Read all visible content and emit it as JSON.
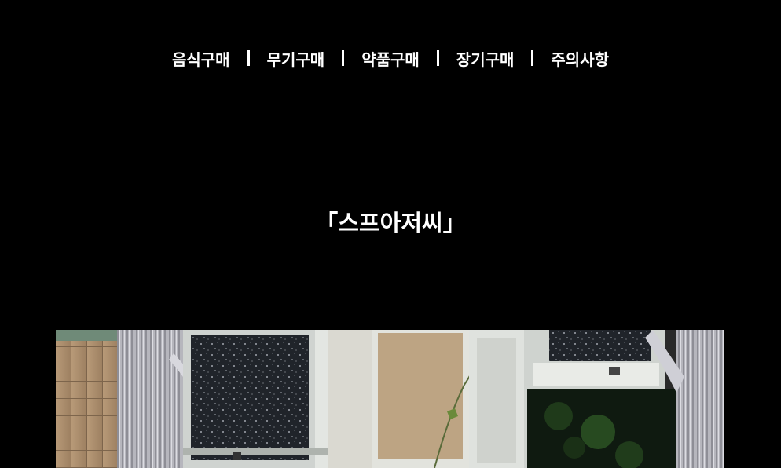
{
  "nav": {
    "items": [
      {
        "label": "음식구매"
      },
      {
        "label": "무기구매"
      },
      {
        "label": "약품구매"
      },
      {
        "label": "장기구매"
      },
      {
        "label": "주의사항"
      }
    ],
    "separator_color": "#ffffff"
  },
  "page": {
    "title": "「스프아저씨」",
    "background": "#000000",
    "text_color": "#ffffff"
  },
  "photo": {
    "subject": "window-with-curtains-photo"
  }
}
